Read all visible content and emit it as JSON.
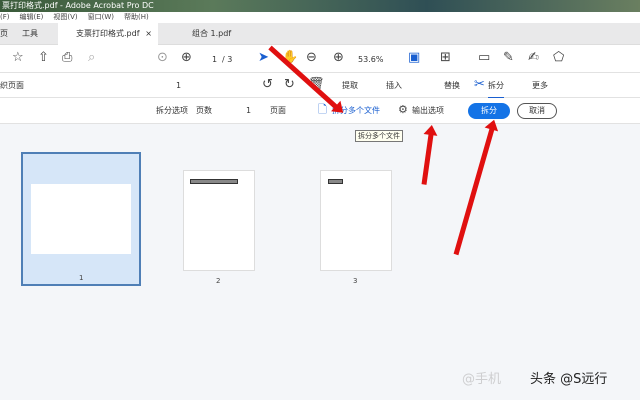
{
  "window": {
    "title": "票打印格式.pdf - Adobe Acrobat Pro DC"
  },
  "menu": [
    "(F)",
    "编辑(E)",
    "视图(V)",
    "窗口(W)",
    "帮助(H)"
  ],
  "tabs": {
    "home": "页",
    "tools": "工具",
    "doc1": "支票打印格式.pdf",
    "doc1_close": "×",
    "doc2": "组合 1.pdf"
  },
  "toolbar": {
    "page_current": "1",
    "page_total": "/ 3",
    "zoom": "53.6%"
  },
  "organize": {
    "title": "织页面",
    "page_select": "1",
    "extract": "提取",
    "insert": "插入",
    "replace": "替换",
    "split": "拆分",
    "more": "更多"
  },
  "split_bar": {
    "options_label": "拆分选项",
    "mode": "页数",
    "count": "1",
    "unit": "页面",
    "split_multiple": "拆分多个文件",
    "output_options": "输出选项",
    "split_button": "拆分",
    "cancel_button": "取消",
    "tooltip": "拆分多个文件"
  },
  "pages": [
    "1",
    "2",
    "3"
  ],
  "watermark": {
    "faint": "@手机",
    "main": "头条 @S远行"
  }
}
